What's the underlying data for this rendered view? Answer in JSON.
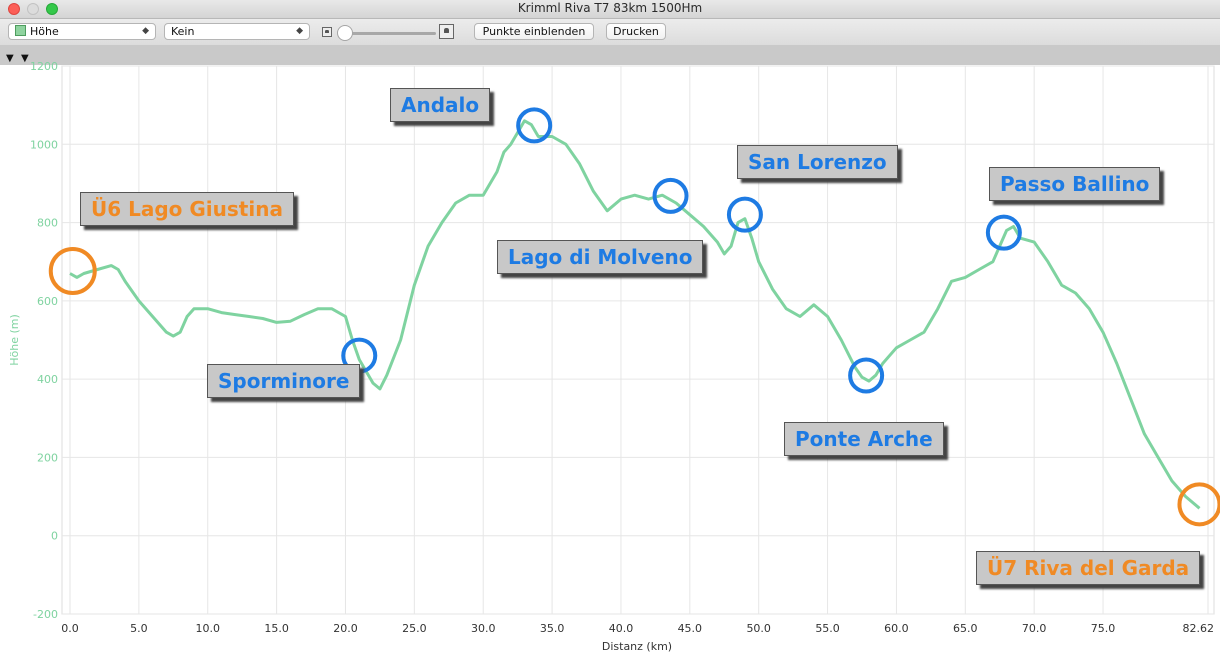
{
  "window": {
    "title": "Krimml Riva T7 83km 1500Hm"
  },
  "toolbar": {
    "metric_select": "Höhe",
    "secondary_select": "Kein",
    "show_points_button": "Punkte einblenden",
    "print_button": "Drucken"
  },
  "colors": {
    "profile_line": "#7fd3a0",
    "label_blue": "#1e7be3",
    "label_orange": "#f08a24"
  },
  "chart_data": {
    "type": "line",
    "xlabel": "Distanz (km)",
    "ylabel": "Höhe (m)",
    "xlim": [
      0,
      82.62
    ],
    "ylim": [
      -200,
      1200
    ],
    "xticks": [
      "0.0",
      "5.0",
      "10.0",
      "15.0",
      "20.0",
      "25.0",
      "30.0",
      "35.0",
      "40.0",
      "45.0",
      "50.0",
      "55.0",
      "60.0",
      "65.0",
      "70.0",
      "75.0",
      "82.62"
    ],
    "yticks": [
      "1200",
      "1000",
      "800",
      "600",
      "400",
      "200",
      "0",
      "-200"
    ],
    "grid": true,
    "x": [
      0,
      0.5,
      1,
      2,
      3,
      3.5,
      4,
      5,
      6,
      7,
      7.5,
      8,
      8.5,
      9,
      10,
      11,
      12,
      13,
      14,
      15,
      16,
      17,
      18,
      19,
      20,
      20.5,
      21,
      21.5,
      22,
      22.5,
      23,
      24,
      25,
      26,
      27,
      28,
      29,
      30,
      31,
      31.5,
      32,
      32.5,
      33,
      33.5,
      34,
      35,
      36,
      37,
      38,
      39,
      40,
      41,
      42,
      43,
      44,
      45,
      46,
      47,
      47.5,
      48,
      48.5,
      49,
      49.5,
      50,
      51,
      52,
      53,
      54,
      55,
      56,
      57,
      57.5,
      58,
      58.5,
      59,
      60,
      61,
      62,
      63,
      64,
      65,
      66,
      67,
      67.5,
      68,
      68.5,
      69,
      70,
      71,
      72,
      73,
      74,
      75,
      76,
      77,
      78,
      79,
      80,
      81,
      82,
      82.62
    ],
    "y": [
      670,
      660,
      670,
      680,
      690,
      680,
      650,
      600,
      560,
      520,
      510,
      520,
      560,
      580,
      580,
      570,
      565,
      560,
      555,
      545,
      548,
      565,
      580,
      580,
      560,
      500,
      450,
      420,
      390,
      375,
      410,
      500,
      640,
      740,
      800,
      850,
      870,
      870,
      930,
      980,
      1000,
      1030,
      1060,
      1050,
      1020,
      1020,
      1000,
      950,
      880,
      830,
      860,
      870,
      860,
      870,
      850,
      820,
      790,
      750,
      720,
      740,
      800,
      810,
      760,
      700,
      630,
      580,
      560,
      590,
      560,
      500,
      430,
      405,
      395,
      410,
      440,
      480,
      500,
      520,
      580,
      650,
      660,
      680,
      700,
      740,
      780,
      790,
      760,
      750,
      700,
      640,
      620,
      580,
      520,
      440,
      350,
      260,
      200,
      140,
      100,
      70
    ]
  },
  "labels": [
    {
      "text": "Ü6 Lago Giustina",
      "color": "orange"
    },
    {
      "text": "Andalo",
      "color": "blue"
    },
    {
      "text": "San Lorenzo",
      "color": "blue"
    },
    {
      "text": "Passo Ballino",
      "color": "blue"
    },
    {
      "text": "Lago di Molveno",
      "color": "blue"
    },
    {
      "text": "Sporminore",
      "color": "blue"
    },
    {
      "text": "Ponte Arche",
      "color": "blue"
    },
    {
      "text": "Ü7 Riva del Garda",
      "color": "orange"
    }
  ]
}
